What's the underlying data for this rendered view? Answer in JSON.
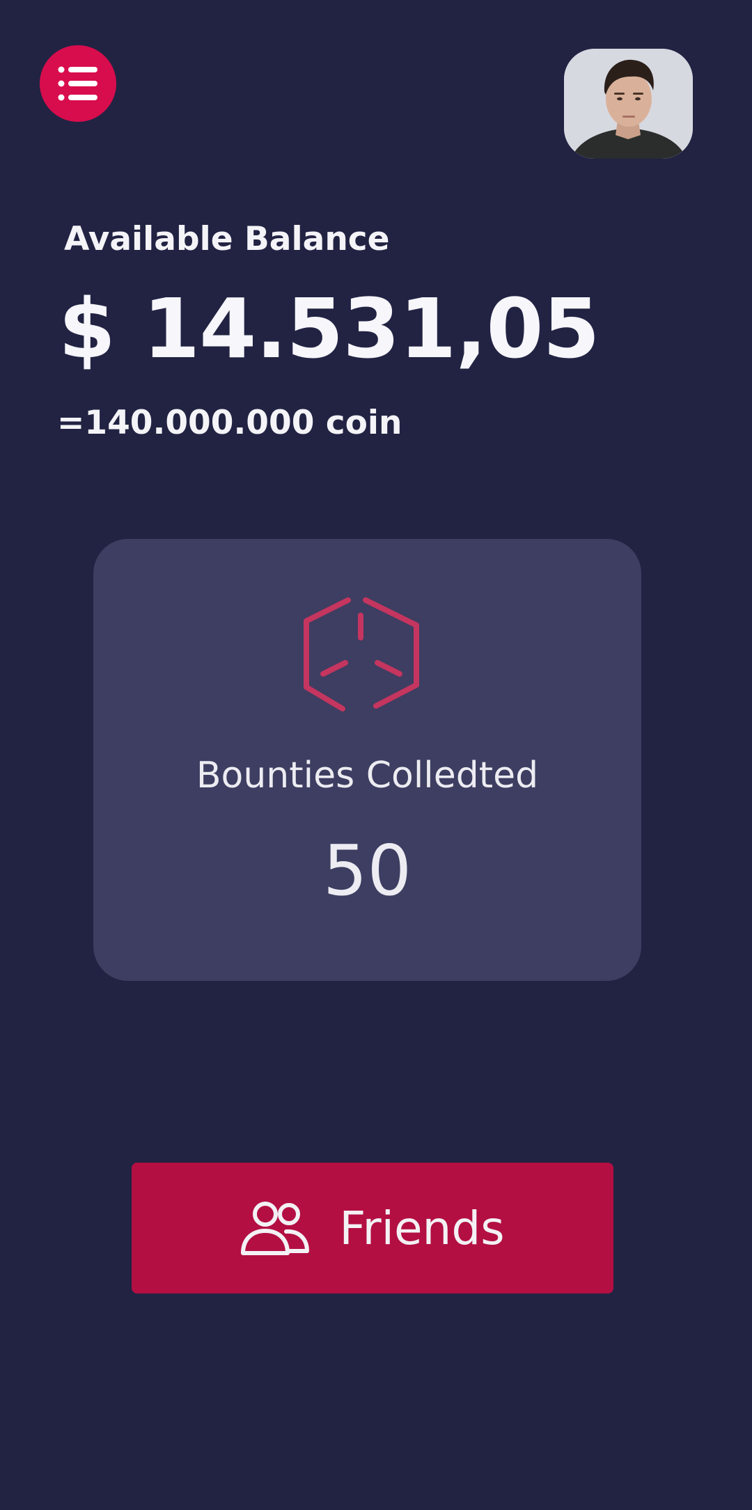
{
  "header": {
    "menu_icon": "list-icon",
    "avatar_alt": "User avatar"
  },
  "balance": {
    "label": "Available Balance",
    "amount": "$ 14.531,05",
    "coin_equivalent": "=140.000.000 coin"
  },
  "bounty_card": {
    "icon": "box-icon",
    "title": "Bounties Colledted",
    "count": "50"
  },
  "friends_button": {
    "icon": "users-icon",
    "label": "Friends"
  },
  "colors": {
    "background": "#222343",
    "card": "#3d3e61",
    "accent": "#d80d4d",
    "button": "#b30f43",
    "icon_pink": "#c4355f"
  }
}
